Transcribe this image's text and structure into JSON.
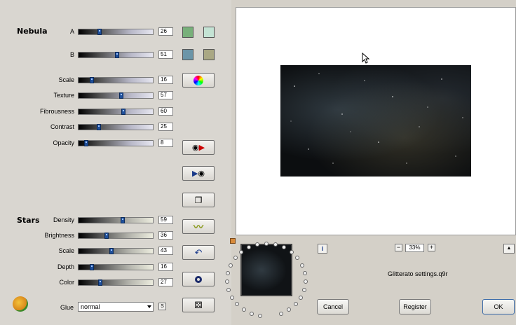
{
  "nebula": {
    "title": "Nebula",
    "sliders": [
      {
        "label": "A",
        "value": "26",
        "fraction": 0.26
      },
      {
        "label": "B",
        "value": "51",
        "fraction": 0.51
      },
      {
        "label": "Scale",
        "value": "16",
        "fraction": 0.16
      },
      {
        "label": "Texture",
        "value": "57",
        "fraction": 0.57
      },
      {
        "label": "Fibrousness",
        "value": "60",
        "fraction": 0.6
      },
      {
        "label": "Contrast",
        "value": "25",
        "fraction": 0.25
      },
      {
        "label": "Opacity",
        "value": "8",
        "fraction": 0.08
      }
    ],
    "swatch_colors": [
      "#78b07a",
      "#c4e3d4",
      "#6b95a8",
      "#aaa884"
    ]
  },
  "stars": {
    "title": "Stars",
    "sliders": [
      {
        "label": "Density",
        "value": "59",
        "fraction": 0.59
      },
      {
        "label": "Brightness",
        "value": "36",
        "fraction": 0.36
      },
      {
        "label": "Scale",
        "value": "43",
        "fraction": 0.43
      },
      {
        "label": "Depth",
        "value": "16",
        "fraction": 0.16
      },
      {
        "label": "Color",
        "value": "27",
        "fraction": 0.27
      }
    ]
  },
  "glue": {
    "label": "Glue",
    "value": "normal",
    "s_label": "S"
  },
  "preview": {
    "zoom": "33%",
    "zoom_minus": "−",
    "zoom_plus": "+",
    "filename": "Glitterato settings.q9r",
    "info": "i",
    "scroll_up": "▲"
  },
  "buttons": {
    "cancel": "Cancel",
    "register": "Register",
    "ok": "OK"
  }
}
